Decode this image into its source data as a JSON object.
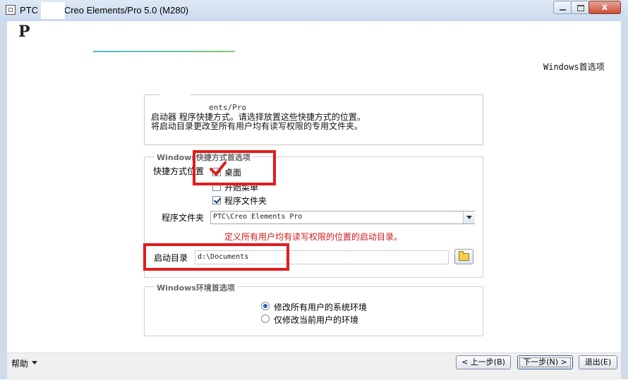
{
  "window": {
    "title": "PTC        - Creo Elements/Pro 5.0 (M280)",
    "min_label": "",
    "max_label": "",
    "close_label": "x"
  },
  "header": {
    "logo_fragment": "P",
    "page_heading": "Windows首选项"
  },
  "info": {
    "title": "ents/Pro",
    "line1": "启动器   程序快捷方式。请选择放置这些快捷方式的位置。",
    "line2": "将启动目录更改至所有用户均有读写权限的专用文件夹。"
  },
  "shortcut_group": {
    "title": "Windows快捷方式首选项",
    "location_label": "快捷方式位置",
    "options": [
      {
        "label": "桌面",
        "checked": true
      },
      {
        "label": "开始菜单",
        "checked": false
      },
      {
        "label": "程序文件夹",
        "checked": true
      }
    ],
    "program_folder_label": "程序文件夹",
    "program_folder_value": "PTC\\Creo Elements Pro",
    "hint": "定义所有用户均有读写权限的位置的启动目录。",
    "start_dir_label": "启动目录",
    "start_dir_value": "d:\\Documents"
  },
  "env_group": {
    "title": "Windows环境首选项",
    "options": [
      {
        "label": "修改所有用户的系统环境",
        "selected": true
      },
      {
        "label": "仅修改当前用户的环境",
        "selected": false
      }
    ]
  },
  "footer": {
    "help_label": "帮助",
    "back_label": "< 上一步(B)",
    "next_label": "下一步(N) >",
    "exit_label": "退出(E)"
  },
  "colors": {
    "annotation": "#e21d1d",
    "hint_text": "#d01818",
    "accent_start": "#4fb6d9",
    "accent_end": "#7ccb6e"
  }
}
